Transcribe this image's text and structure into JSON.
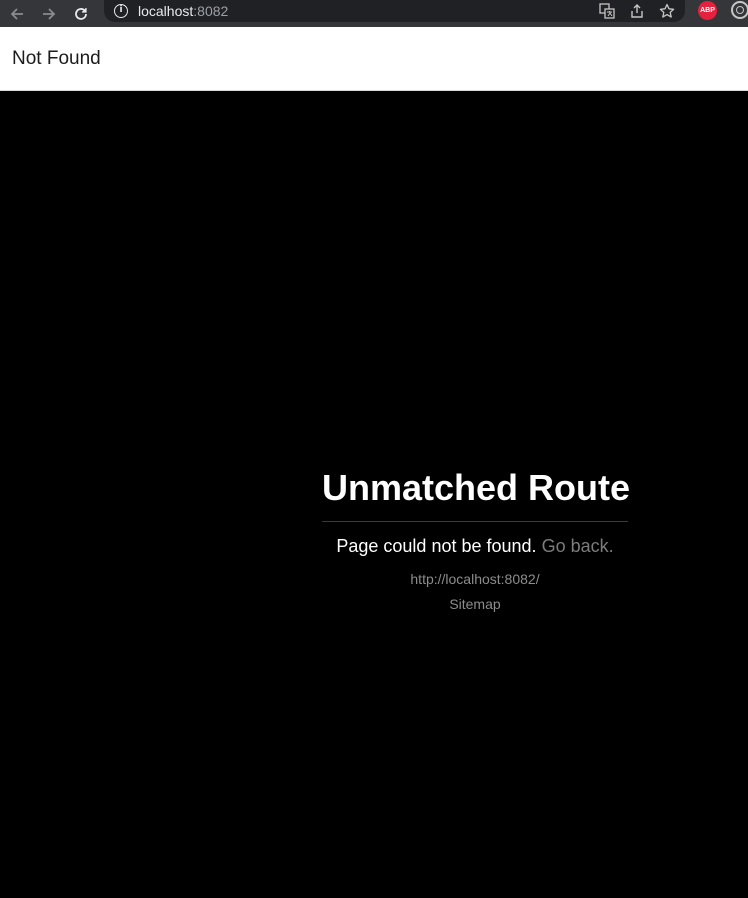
{
  "browser": {
    "url_host": "localhost",
    "url_port": ":8082",
    "extension_abp_label": "ABP"
  },
  "header": {
    "title": "Not Found"
  },
  "main": {
    "heading": "Unmatched Route",
    "message": "Page could not be found.",
    "go_back_label": "Go back.",
    "route_url": "http://localhost:8082/",
    "sitemap_label": "Sitemap"
  }
}
